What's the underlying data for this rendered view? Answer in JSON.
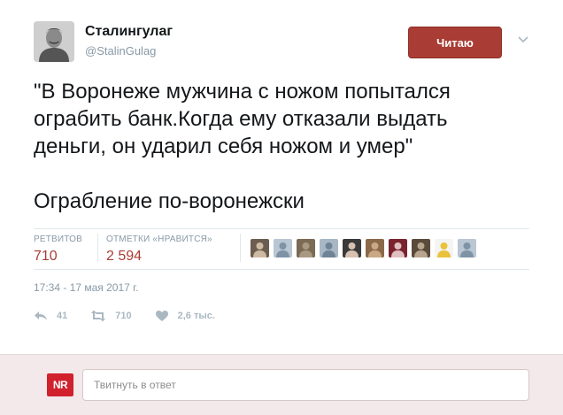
{
  "author": {
    "name": "Сталингулаг",
    "handle": "@StalinGulag"
  },
  "follow_button": {
    "label": "Читаю"
  },
  "tweet": {
    "lines": [
      "\"В Воронеже мужчина с ножом попытался",
      "ограбить банк.Когда ему отказали выдать",
      "деньги, он ударил себя ножом и умер\""
    ],
    "tagline": "Ограбление по-воронежски"
  },
  "stats": {
    "retweets_label": "РЕТВИТОВ",
    "retweets_value": "710",
    "likes_label": "ОТМЕТКИ «НРАВИТСЯ»",
    "likes_value": "2 594"
  },
  "likers_count": 10,
  "timestamp": "17:34 - 17 мая 2017 г.",
  "actions": {
    "reply_count": "41",
    "retweet_count": "710",
    "like_count": "2,6 тыс."
  },
  "reply": {
    "logo": "NR",
    "placeholder": "Твитнуть в ответ"
  },
  "icons": [
    "reply-icon",
    "retweet-icon",
    "heart-icon",
    "chevron-down-icon"
  ],
  "colors": {
    "accent": "#a93c34",
    "muted": "#8899a6",
    "reply_bar_bg": "#f3e9ea",
    "logo_red": "#d0212d"
  }
}
